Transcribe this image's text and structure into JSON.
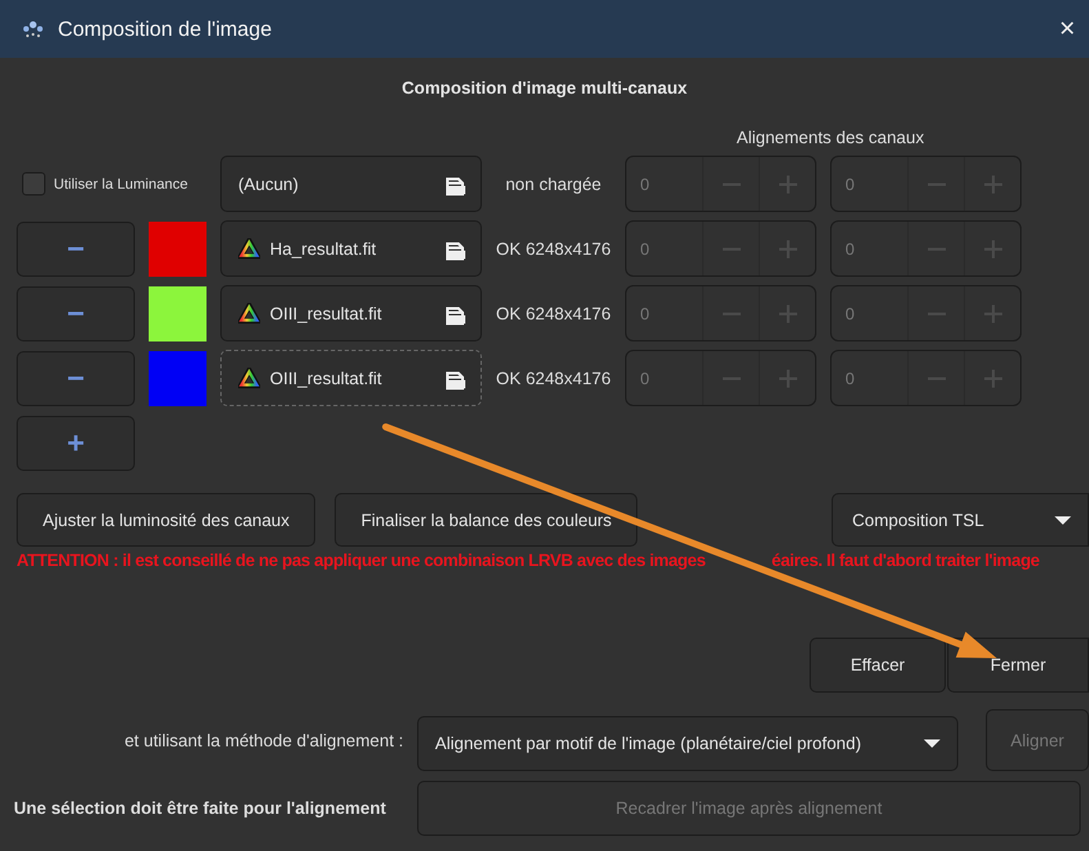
{
  "window": {
    "title": "Composition de l'image",
    "close": "×"
  },
  "heading": "Composition d'image multi-canaux",
  "alignment_header": "Alignements des canaux",
  "channels": [
    {
      "kind": "luminance",
      "checkbox_label": "Utiliser la Luminance",
      "checked": false,
      "file": "(Aucun)",
      "file_icon": false,
      "focused": false,
      "status": "non chargée",
      "offsets": [
        "0",
        "0"
      ]
    },
    {
      "kind": "channel",
      "remove": "−",
      "color": "#e00000",
      "file": "Ha_resultat.fit",
      "file_icon": true,
      "focused": false,
      "status": "OK 6248x4176",
      "offsets": [
        "0",
        "0"
      ]
    },
    {
      "kind": "channel",
      "remove": "−",
      "color": "#8cf53c",
      "file": "OIII_resultat.fit",
      "file_icon": true,
      "focused": false,
      "status": "OK 6248x4176",
      "offsets": [
        "0",
        "0"
      ]
    },
    {
      "kind": "channel",
      "remove": "−",
      "color": "#0000f5",
      "file": "OIII_resultat.fit",
      "file_icon": true,
      "focused": true,
      "status": "OK 6248x4176",
      "offsets": [
        "0",
        "0"
      ]
    }
  ],
  "add_button": "+",
  "buttons": [
    {
      "label": "Ajuster la luminosité des canaux",
      "disabled": false
    },
    {
      "label": "Finaliser la balance des couleurs",
      "disabled": false
    }
  ],
  "mode_dropdown": "Composition TSL",
  "warning": [
    "ATTENTION : il est conseillé de ne pas appliquer une combinaison LRVB avec des images",
    "éaires. Il faut d'abord traiter l'image"
  ],
  "dialog_buttons": [
    {
      "label": "Effacer",
      "disabled": false
    },
    {
      "label": "Fermer",
      "disabled": false
    }
  ],
  "alignment": {
    "method_label": "et utilisant la méthode d'alignement :",
    "method": "Alignement par motif de l'image (planétaire/ciel profond)",
    "align_button": {
      "label": "Aligner",
      "disabled": true
    },
    "selection_note": "Une sélection doit être faite pour l'alignement",
    "crop_button": {
      "label": "Recadrer l'image après alignement",
      "disabled": true
    }
  },
  "annotation": {
    "kind": "arrow"
  }
}
